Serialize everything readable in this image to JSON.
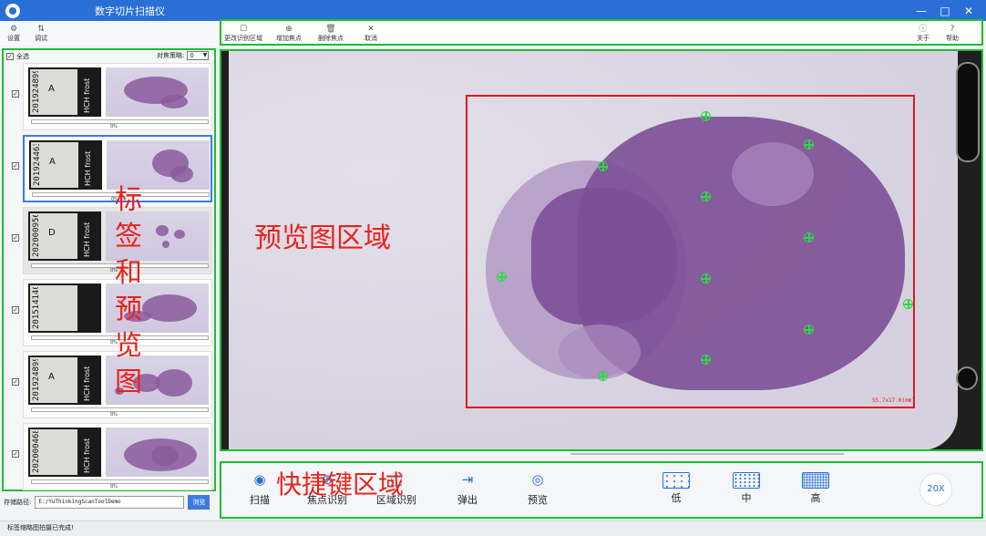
{
  "window": {
    "title": "数字切片扫描仪",
    "controls": [
      "—",
      "□",
      "✕"
    ]
  },
  "left_toolbar": [
    {
      "label": "设置",
      "icon": "gear-icon",
      "glyph": "⚙"
    },
    {
      "label": "调试",
      "icon": "debug-icon",
      "glyph": "⇅"
    }
  ],
  "slide_list": {
    "select_all_label": "全选",
    "strategy_label": "对焦策略:",
    "strategy_value": "0",
    "items": [
      {
        "code": "201924899",
        "letter": "A",
        "frost": "HCH frost",
        "progress": "0%",
        "selected": false,
        "checked": true
      },
      {
        "code": "201924463",
        "letter": "A",
        "frost": "HCH frost",
        "progress": "0%",
        "selected": true,
        "checked": true
      },
      {
        "code": "202000956",
        "letter": "D",
        "frost": "HCH frost",
        "progress": "0%",
        "selected": false,
        "checked": true
      },
      {
        "code": "2015141400",
        "letter": "",
        "frost": "",
        "progress": "0%",
        "selected": false,
        "checked": true
      },
      {
        "code": "201924899",
        "letter": "A",
        "frost": "HCH frost",
        "progress": "0%",
        "selected": false,
        "checked": true
      },
      {
        "code": "202000468",
        "letter": "",
        "frost": "HCH frost",
        "progress": "0%",
        "selected": false,
        "checked": true
      }
    ],
    "overlay_chars": [
      "标",
      "签",
      "和",
      "预",
      "览",
      "图"
    ]
  },
  "storage": {
    "label": "存储路径:",
    "value": "E:/YuThinkingScanToolDemo",
    "browse_label": "浏览"
  },
  "status_text": "标签缩略图拍摄已完成!",
  "preview_toolbar": {
    "left": [
      {
        "label": "更改识别区域",
        "icon": "edit-region-icon",
        "glyph": "☐"
      },
      {
        "label": "增加焦点",
        "icon": "add-focus-icon",
        "glyph": "⊕"
      },
      {
        "label": "删除焦点",
        "icon": "delete-focus-icon",
        "glyph": "🗑"
      },
      {
        "label": "取消",
        "icon": "cancel-icon",
        "glyph": "✕"
      }
    ],
    "right": [
      {
        "label": "关于",
        "icon": "info-icon",
        "glyph": "ⓘ"
      },
      {
        "label": "帮助",
        "icon": "help-icon",
        "glyph": "?"
      }
    ]
  },
  "preview": {
    "overlay_label": "预览图区域",
    "scale_text": "55.7x17.0(mm)",
    "focus_point_count": 11
  },
  "shortcuts": {
    "overlay_label": "快捷键区域",
    "buttons": [
      {
        "label": "扫描",
        "icon": "scan-icon",
        "glyph": "◉"
      },
      {
        "label": "焦点识别",
        "icon": "focus-detect-icon",
        "glyph": "⊕"
      },
      {
        "label": "区域识别",
        "icon": "region-detect-icon",
        "glyph": "⬚"
      },
      {
        "label": "弹出",
        "icon": "eject-icon",
        "glyph": "⇥"
      },
      {
        "label": "预览",
        "icon": "eye-icon",
        "glyph": "◎"
      }
    ],
    "density": [
      {
        "label": "低",
        "icon": "density-low-icon"
      },
      {
        "label": "中",
        "icon": "density-mid-icon"
      },
      {
        "label": "高",
        "icon": "density-high-icon"
      }
    ],
    "zoom_label": "20X"
  },
  "colors": {
    "accent": "#2a6fd6",
    "region_border": "#1bbf2f",
    "scan_rect": "#e01a1a",
    "focus_point": "#2bd94a",
    "annotation_text": "#e8231b"
  }
}
